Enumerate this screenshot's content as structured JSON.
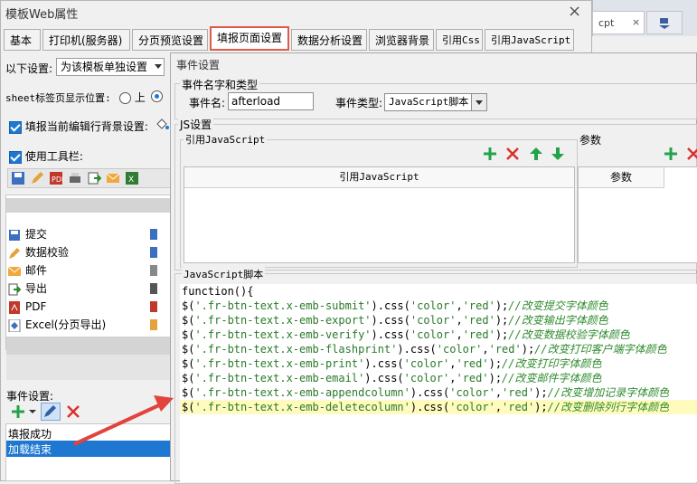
{
  "background_window": {
    "tab_file": "cpt",
    "tab_close": "×"
  },
  "dialog": {
    "title": "模板Web属性",
    "close": "×",
    "tabs": [
      "基本",
      "打印机(服务器)",
      "分页预览设置",
      "填报页面设置",
      "数据分析设置",
      "浏览器背景",
      "引用Css",
      "引用JavaScript"
    ],
    "active_tab": "填报页面设置"
  },
  "left_panel": {
    "mode_label": "以下设置:",
    "mode_value": "为该模板单独设置",
    "sheet_pos_label": "sheet标签页显示位置:",
    "sheet_pos_option": "上",
    "bg_check_label": "填报当前编辑行背景设置:",
    "toolbar_check_label": "使用工具栏:",
    "buttons": [
      {
        "label": "提交",
        "icon": "save-icon"
      },
      {
        "label": "数据校验",
        "icon": "pencil-icon"
      },
      {
        "label": "邮件",
        "icon": "mail-icon"
      },
      {
        "label": "导出",
        "icon": "export-icon"
      },
      {
        "label": "PDF",
        "icon": "pdf-icon"
      },
      {
        "label": "Excel(分页导出)",
        "icon": "excel-icon"
      }
    ],
    "event_label": "事件设置:",
    "events": [
      "填报成功",
      "加载结束"
    ],
    "selected_event": "加载结束"
  },
  "event_dialog": {
    "title": "事件设置",
    "name_group": "事件名字和类型",
    "name_label": "事件名:",
    "name_value": "afterload",
    "type_label": "事件类型:",
    "type_value": "JavaScript脚本",
    "js_group": "JS设置",
    "ref_js_group": "引用JavaScript",
    "params_group": "参数",
    "ref_js_col": "引用JavaScript",
    "params_col": "参数",
    "script_group": "JavaScript脚本",
    "code_header": "function(){",
    "code_lines": [
      {
        "sel": "'.fr-btn-text.x-emb-submit'",
        "prop": "'color'",
        "val": "'red'",
        "comment": "//改变提交字体颜色"
      },
      {
        "sel": "'.fr-btn-text.x-emb-export'",
        "prop": "'color'",
        "val": "'red'",
        "comment": "//改变输出字体颜色"
      },
      {
        "sel": "'.fr-btn-text.x-emb-verify'",
        "prop": "'color'",
        "val": "'red'",
        "comment": "//改变数据校验字体颜色"
      },
      {
        "sel": "'.fr-btn-text.x-emb-flashprint'",
        "prop": "'color'",
        "val": "'red'",
        "comment": "//改变打印客户端字体颜色"
      },
      {
        "sel": "'.fr-btn-text.x-emb-print'",
        "prop": "'color'",
        "val": "'red'",
        "comment": "//改变打印字体颜色"
      },
      {
        "sel": "'.fr-btn-text.x-emb-email'",
        "prop": "'color'",
        "val": "'red'",
        "comment": "//改变邮件字体颜色"
      },
      {
        "sel": "'.fr-btn-text.x-emb-appendcolumn'",
        "prop": "'color'",
        "val": "'red'",
        "comment": "//改变增加记录字体颜色"
      },
      {
        "sel": "'.fr-btn-text.x-emb-deletecolumn'",
        "prop": "'color'",
        "val": "'red'",
        "comment": "//改变删除列行字体颜色"
      }
    ]
  },
  "colors": {
    "accent_blue": "#1e78d2",
    "tab_highlight": "#e05a4a",
    "add_green": "#22a34a",
    "delete_red": "#d9312b",
    "code_string": "#2a7a2a",
    "annotation_arrow": "#e0443c"
  }
}
